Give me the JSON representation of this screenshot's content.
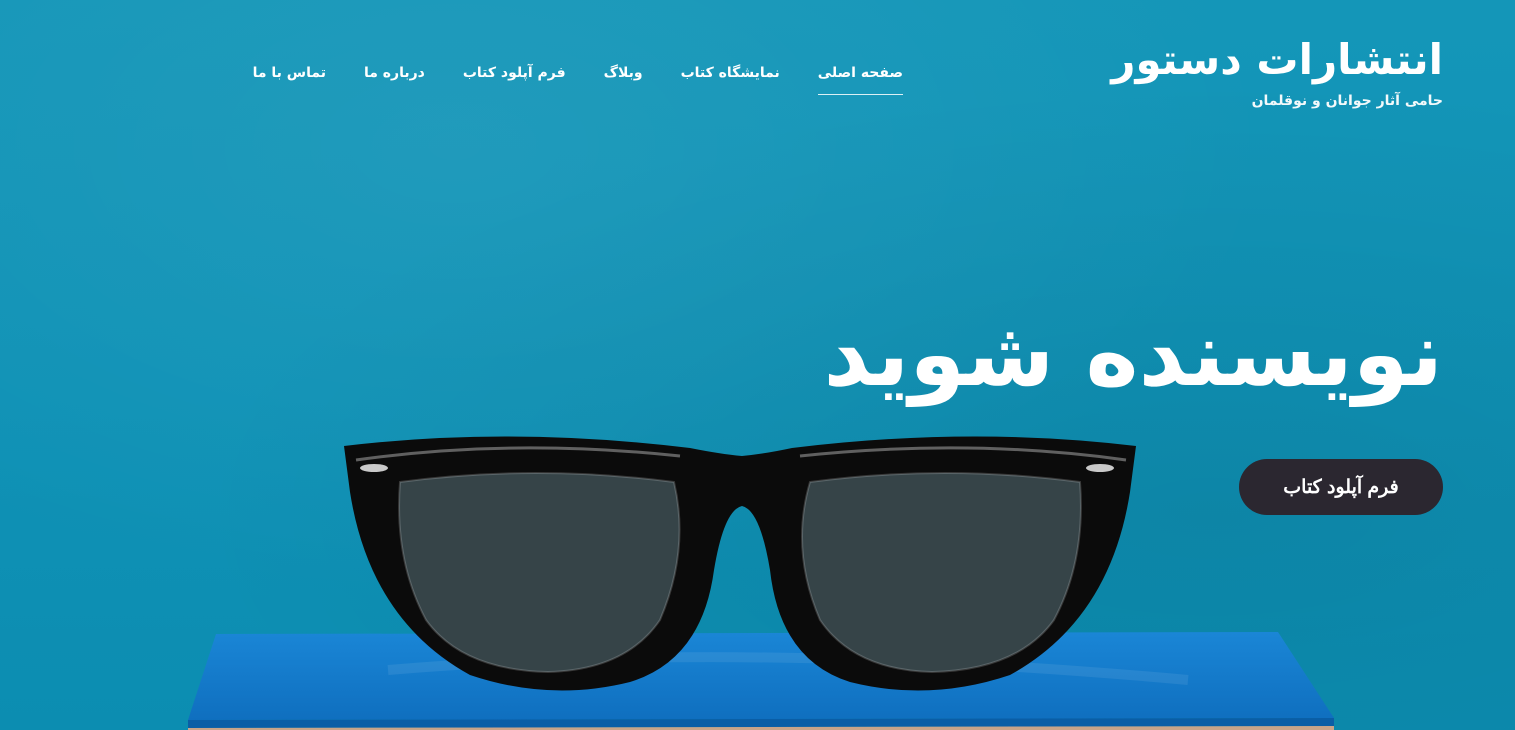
{
  "brand": {
    "title": "انتشارات دستور",
    "tagline": "حامی آثار جوانان و نوقلمان"
  },
  "nav": {
    "items": [
      {
        "label": "صفحه اصلی",
        "active": true
      },
      {
        "label": "نمایشگاه کتاب",
        "active": false
      },
      {
        "label": "وبلاگ",
        "active": false
      },
      {
        "label": "فرم آپلود کتاب",
        "active": false
      },
      {
        "label": "درباره ما",
        "active": false
      },
      {
        "label": "تماس با ما",
        "active": false
      }
    ]
  },
  "hero": {
    "headline": "نویسنده شوید",
    "cta_label": "فرم آپلود کتاب"
  },
  "colors": {
    "background": "#1496b8",
    "cta_background": "#2b2730",
    "text": "#ffffff"
  },
  "icons": {
    "illustration": "eyeglasses-on-book"
  }
}
